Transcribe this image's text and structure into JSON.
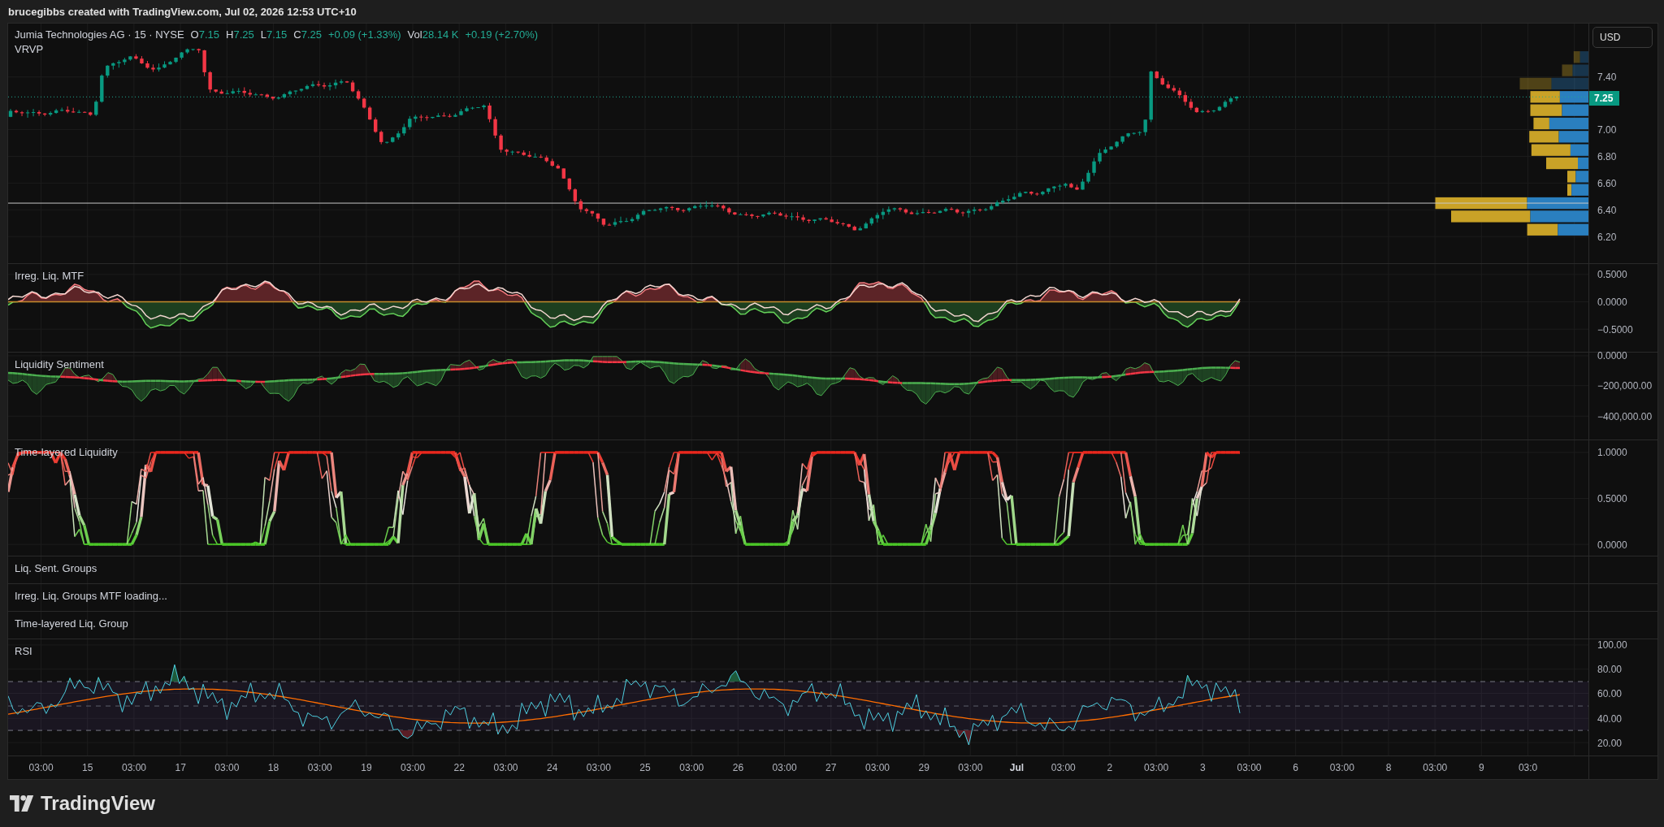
{
  "header": {
    "caption": "brucegibbs created with TradingView.com, Jul 02, 2026 12:53 UTC+10"
  },
  "legend": {
    "symbol": "Jumia Technologies AG · 15 · NYSE",
    "values": [
      {
        "label": "O",
        "value": "7.15"
      },
      {
        "label": "H",
        "value": "7.25"
      },
      {
        "label": "L",
        "value": "7.15"
      },
      {
        "label": "C",
        "value": "7.25"
      }
    ],
    "change": "+0.09 (+1.33%)",
    "volume_label": "Vol",
    "volume": "28.14 K",
    "volume_change": "+0.19 (+2.70%)"
  },
  "currency_button": "USD",
  "panes": [
    {
      "kind": "price",
      "title": "VRVP",
      "axis_labels": [
        {
          "text": "7.40",
          "kind": "tick"
        },
        {
          "text": "7.25",
          "kind": "last_price"
        },
        {
          "text": "7.00",
          "kind": "tick"
        },
        {
          "text": "6.80",
          "kind": "tick"
        },
        {
          "text": "6.60",
          "kind": "tick"
        },
        {
          "text": "6.40",
          "kind": "tick"
        },
        {
          "text": "6.20",
          "kind": "tick"
        }
      ]
    },
    {
      "kind": "irregular",
      "title": "Irreg. Liq. MTF",
      "axis_labels": [
        {
          "text": "0.5000",
          "kind": "tick"
        },
        {
          "text": "0.0000",
          "kind": "tick"
        },
        {
          "text": "−0.5000",
          "kind": "tick"
        }
      ]
    },
    {
      "kind": "sentiment",
      "title": "Liquidity Sentiment",
      "axis_labels": [
        {
          "text": "0.0000",
          "kind": "tick"
        },
        {
          "text": "−200,000.00",
          "kind": "tick"
        },
        {
          "text": "−400,000.00",
          "kind": "tick"
        }
      ]
    },
    {
      "kind": "layered",
      "title": "Time-layered Liquidity",
      "axis_labels": [
        {
          "text": "1.0000",
          "kind": "tick"
        },
        {
          "text": "0.5000",
          "kind": "tick"
        },
        {
          "text": "0.0000",
          "kind": "tick"
        }
      ]
    },
    {
      "kind": "empty",
      "title": "Liq. Sent. Groups"
    },
    {
      "kind": "empty",
      "title": "Irreg. Liq. Groups MTF loading..."
    },
    {
      "kind": "empty",
      "title": "Time-layered Liq. Group"
    },
    {
      "kind": "rsi",
      "title": "RSI",
      "axis_labels": [
        {
          "text": "100.00",
          "kind": "tick"
        },
        {
          "text": "80.00",
          "kind": "tick"
        },
        {
          "text": "60.00",
          "kind": "tick"
        },
        {
          "text": "40.00",
          "kind": "tick"
        },
        {
          "text": "20.00",
          "kind": "tick"
        }
      ]
    }
  ],
  "time_axis": [
    {
      "text": "03:00",
      "kind": "time"
    },
    {
      "text": "15",
      "kind": "day"
    },
    {
      "text": "03:00",
      "kind": "time"
    },
    {
      "text": "17",
      "kind": "day"
    },
    {
      "text": "03:00",
      "kind": "time"
    },
    {
      "text": "18",
      "kind": "day"
    },
    {
      "text": "03:00",
      "kind": "time"
    },
    {
      "text": "19",
      "kind": "day"
    },
    {
      "text": "03:00",
      "kind": "time"
    },
    {
      "text": "22",
      "kind": "day"
    },
    {
      "text": "03:00",
      "kind": "time"
    },
    {
      "text": "24",
      "kind": "day"
    },
    {
      "text": "03:00",
      "kind": "time"
    },
    {
      "text": "25",
      "kind": "day"
    },
    {
      "text": "03:00",
      "kind": "time"
    },
    {
      "text": "26",
      "kind": "day"
    },
    {
      "text": "03:00",
      "kind": "time"
    },
    {
      "text": "27",
      "kind": "day"
    },
    {
      "text": "03:00",
      "kind": "time"
    },
    {
      "text": "29",
      "kind": "day"
    },
    {
      "text": "03:00",
      "kind": "time"
    },
    {
      "text": "Jul",
      "kind": "month"
    },
    {
      "text": "03:00",
      "kind": "time"
    },
    {
      "text": "2",
      "kind": "day"
    },
    {
      "text": "03:00",
      "kind": "time"
    },
    {
      "text": "3",
      "kind": "day"
    },
    {
      "text": "03:00",
      "kind": "time"
    },
    {
      "text": "6",
      "kind": "day"
    },
    {
      "text": "03:00",
      "kind": "time"
    },
    {
      "text": "8",
      "kind": "day"
    },
    {
      "text": "03:00",
      "kind": "time"
    },
    {
      "text": "9",
      "kind": "day"
    },
    {
      "text": "03:0",
      "kind": "time"
    }
  ],
  "footer": {
    "brand": "TradingView"
  }
}
